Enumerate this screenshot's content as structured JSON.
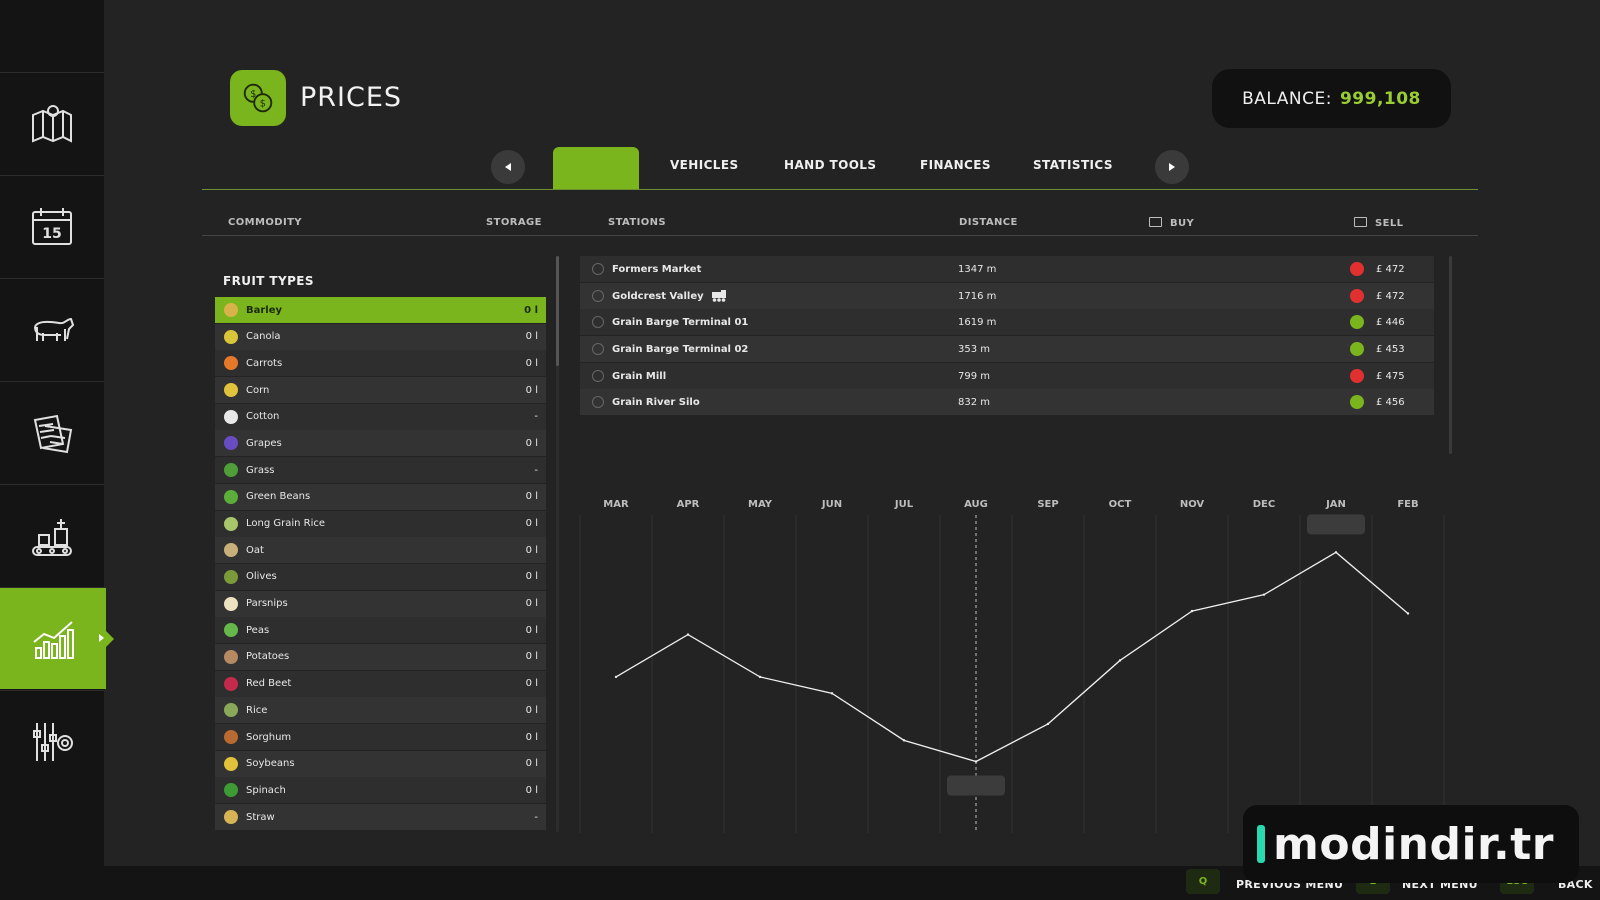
{
  "header": {
    "title": "PRICES"
  },
  "balance": {
    "label": "BALANCE:",
    "value": "999,108"
  },
  "tabs": [
    {
      "label": ""
    },
    {
      "label": "VEHICLES"
    },
    {
      "label": "HAND TOOLS"
    },
    {
      "label": "FINANCES"
    },
    {
      "label": "STATISTICS"
    }
  ],
  "columns": {
    "commodity": "COMMODITY",
    "storage": "STORAGE",
    "stations": "STATIONS",
    "distance": "DISTANCE",
    "buy": "BUY",
    "sell": "SELL"
  },
  "fruit_types_title": "FRUIT TYPES",
  "commodities": [
    {
      "name": "Barley",
      "storage": "0 l",
      "icon": "barley-icon",
      "color": "#d8b24a"
    },
    {
      "name": "Canola",
      "storage": "0 l",
      "icon": "canola-icon",
      "color": "#d8c53a"
    },
    {
      "name": "Carrots",
      "storage": "0 l",
      "icon": "carrot-icon",
      "color": "#e6782a"
    },
    {
      "name": "Corn",
      "storage": "0 l",
      "icon": "corn-icon",
      "color": "#e0c23c"
    },
    {
      "name": "Cotton",
      "storage": "-",
      "icon": "cotton-icon",
      "color": "#e8e8e8"
    },
    {
      "name": "Grapes",
      "storage": "0 l",
      "icon": "grapes-icon",
      "color": "#6a4cc2"
    },
    {
      "name": "Grass",
      "storage": "-",
      "icon": "grass-icon",
      "color": "#4f9e3a"
    },
    {
      "name": "Green Beans",
      "storage": "0 l",
      "icon": "green-beans-icon",
      "color": "#5cae3a"
    },
    {
      "name": "Long Grain Rice",
      "storage": "0 l",
      "icon": "long-grain-rice-icon",
      "color": "#a9c56a"
    },
    {
      "name": "Oat",
      "storage": "0 l",
      "icon": "oat-icon",
      "color": "#c9b07a"
    },
    {
      "name": "Olives",
      "storage": "0 l",
      "icon": "olives-icon",
      "color": "#7b9a3a"
    },
    {
      "name": "Parsnips",
      "storage": "0 l",
      "icon": "parsnip-icon",
      "color": "#ece2c2"
    },
    {
      "name": "Peas",
      "storage": "0 l",
      "icon": "peas-icon",
      "color": "#66b84a"
    },
    {
      "name": "Potatoes",
      "storage": "0 l",
      "icon": "potato-icon",
      "color": "#b58a62"
    },
    {
      "name": "Red Beet",
      "storage": "0 l",
      "icon": "red-beet-icon",
      "color": "#c42a4a"
    },
    {
      "name": "Rice",
      "storage": "0 l",
      "icon": "rice-icon",
      "color": "#8aa85a"
    },
    {
      "name": "Sorghum",
      "storage": "0 l",
      "icon": "sorghum-icon",
      "color": "#b86a32"
    },
    {
      "name": "Soybeans",
      "storage": "0 l",
      "icon": "soybean-icon",
      "color": "#e2c23a"
    },
    {
      "name": "Spinach",
      "storage": "0 l",
      "icon": "spinach-icon",
      "color": "#3e9a34"
    },
    {
      "name": "Straw",
      "storage": "-",
      "icon": "straw-icon",
      "color": "#d6b456"
    }
  ],
  "stations": [
    {
      "name": "Formers Market",
      "distance": "1347  m",
      "trend": "down",
      "price": "£  472",
      "train": false
    },
    {
      "name": "Goldcrest Valley",
      "distance": "1716  m",
      "trend": "down",
      "price": "£  472",
      "train": true
    },
    {
      "name": "Grain Barge Terminal 01",
      "distance": "1619  m",
      "trend": "up",
      "price": "£  446",
      "train": false
    },
    {
      "name": "Grain Barge Terminal 02",
      "distance": "353  m",
      "trend": "up",
      "price": "£  453",
      "train": false
    },
    {
      "name": "Grain Mill",
      "distance": "799  m",
      "trend": "down",
      "price": "£  475",
      "train": false
    },
    {
      "name": "Grain River Silo",
      "distance": "832  m",
      "trend": "up",
      "price": "£  456",
      "train": false
    }
  ],
  "chart_data": {
    "type": "line",
    "categories": [
      "MAR",
      "APR",
      "MAY",
      "JUN",
      "JUL",
      "AUG",
      "SEP",
      "OCT",
      "NOV",
      "DEC",
      "JAN",
      "FEB"
    ],
    "series": [
      {
        "values": [
          0.46,
          0.64,
          0.46,
          0.39,
          0.19,
          0.1,
          0.26,
          0.53,
          0.74,
          0.81,
          0.99,
          0.73
        ]
      }
    ],
    "ylim": [
      0,
      1
    ],
    "current_month": "AUG",
    "line_color": "#f0f0f0"
  },
  "footer": {
    "prev": {
      "key": "Q",
      "label": "PREVIOUS MENU"
    },
    "next": {
      "key": "E",
      "label": "NEXT MENU"
    },
    "back": {
      "key": "ESC",
      "label": "BACK"
    }
  },
  "watermark": "modindir.tr",
  "colors": {
    "accent": "#7ab51d",
    "balance": "#9acd32",
    "down": "#e23030"
  }
}
